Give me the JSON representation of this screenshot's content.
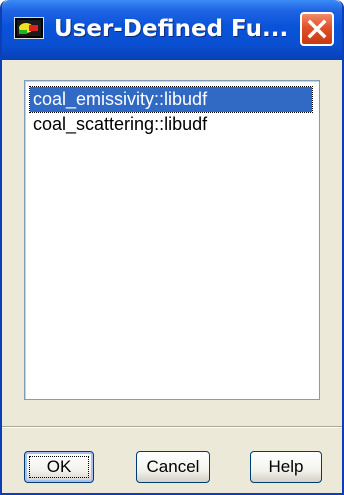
{
  "window": {
    "title": "User-Defined Fu...",
    "icon": "app-window-icon",
    "close_icon": "close-icon"
  },
  "functions_list": {
    "items": [
      {
        "label": "coal_emissivity::libudf",
        "selected": true
      },
      {
        "label": "coal_scattering::libudf",
        "selected": false
      }
    ]
  },
  "buttons": {
    "ok": "OK",
    "cancel": "Cancel",
    "help": "Help"
  },
  "colors": {
    "titlebar": "#0a4fd2",
    "selection": "#316ac5",
    "close": "#e0512a",
    "dialog_bg": "#ece9d8"
  }
}
